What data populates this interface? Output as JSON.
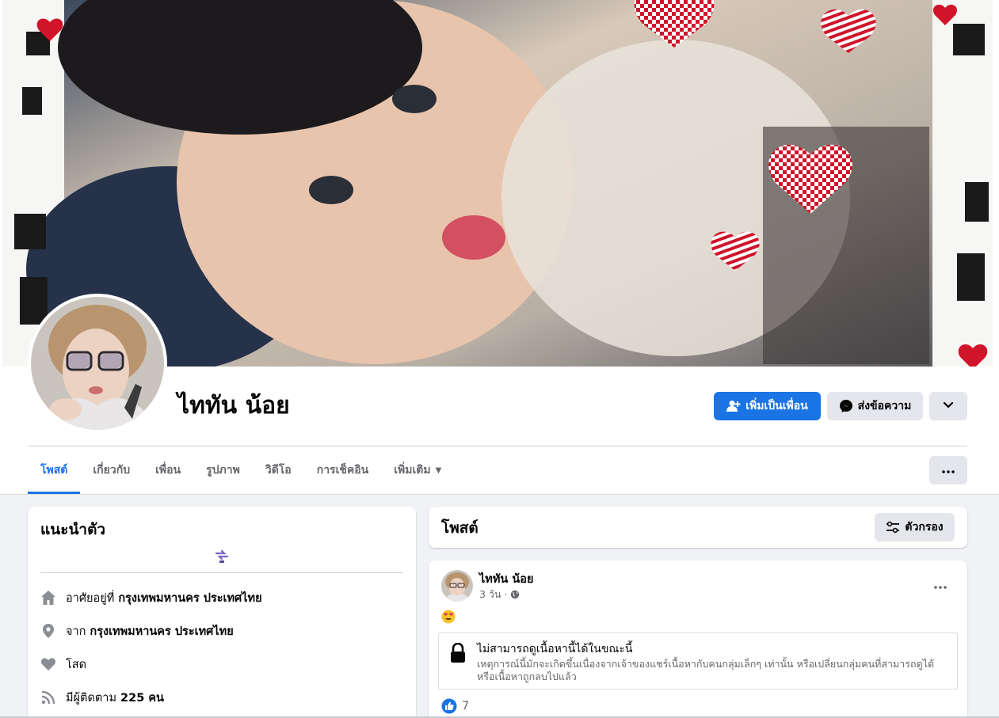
{
  "profile": {
    "name": "ไททัน น้อย",
    "add_friend_label": "เพิ่มเป็นเพื่อน",
    "message_label": "ส่งข้อความ"
  },
  "tabs": [
    {
      "label": "โพสต์",
      "active": true
    },
    {
      "label": "เกี่ยวกับ"
    },
    {
      "label": "เพื่อน"
    },
    {
      "label": "รูปภาพ"
    },
    {
      "label": "วิดีโอ"
    },
    {
      "label": "การเช็คอิน"
    },
    {
      "label": "เพิ่มเติม"
    }
  ],
  "intro": {
    "title": "แนะนำตัว",
    "lives_prefix": "อาศัยอยู่ที่",
    "lives_value": "กรุงเทพมหานคร ประเทศไทย",
    "from_prefix": "จาก",
    "from_value": "กรุงเทพมหานคร ประเทศไทย",
    "relationship": "โสด",
    "followers_prefix": "มีผู้ติดตาม",
    "followers_value": "225 คน"
  },
  "posts": {
    "title": "โพสต์",
    "filter_label": "ตัวกรอง",
    "items": [
      {
        "author": "ไททัน น้อย",
        "time": "3 วัน ·",
        "unavailable_title": "ไม่สามารถดูเนื้อหานี้ได้ในขณะนี้",
        "unavailable_text": "เหตุการณ์นี้มักจะเกิดขึ้นเนื่องจากเจ้าของแชร์เนื้อหากับคนกลุ่มเล็กๆ เท่านั้น หรือเปลี่ยนกลุ่มคนที่สามารถดูได้ หรือเนื้อหาถูกลบไปแล้ว",
        "likes": "7"
      }
    ]
  },
  "colors": {
    "accent": "#1b74e4",
    "background": "#f0f2f5",
    "secondary_button": "#e4e6eb",
    "muted_text": "#65676b"
  },
  "icons": {
    "add_friend": "person-plus-icon",
    "message": "messenger-icon",
    "dropdown": "chevron-down-icon",
    "more": "ellipsis-icon",
    "filter": "sliders-icon",
    "home": "home-icon",
    "location": "location-pin-icon",
    "relationship": "heart-icon",
    "followers": "rss-icon",
    "privacy": "globe-icon",
    "lock": "lock-icon",
    "like": "like-icon",
    "emoji": "heart-eyes-emoji"
  }
}
